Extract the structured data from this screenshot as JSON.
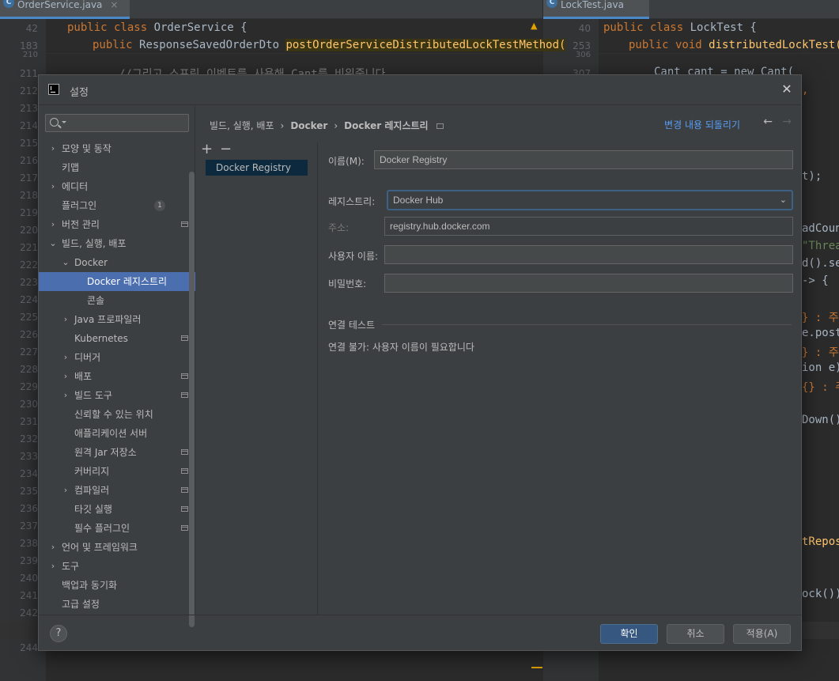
{
  "editor": {
    "left_tab": "OrderService.java",
    "right_tab": "LockTest.java",
    "left_sticky": [
      {
        "num": "42",
        "code_kw": "public class ",
        "code_rest": "OrderService {"
      },
      {
        "num": "183",
        "code_kw": "public ",
        "code_rest": "ResponseSavedOrderDto ",
        "code_fn": "postOrderServiceDistributedLockTestMethod("
      }
    ],
    "right_sticky": [
      {
        "num": "40",
        "code_kw": "public class ",
        "code_rest": "LockTest {"
      },
      {
        "num": "253",
        "code_kw": "public void ",
        "code_fn": "distributedLockTest()"
      }
    ],
    "left_comment": "//그리고 스프링 이벤트를 사용해 Cant를 비워줍니다",
    "left_line_numbers": [
      "210",
      "211",
      "212",
      "213",
      "214",
      "215",
      "216",
      "217",
      "218",
      "219",
      "220",
      "221",
      "222",
      "223",
      "224",
      "225",
      "226",
      "227",
      "228",
      "229",
      "230",
      "231",
      "232",
      "233",
      "234",
      "235",
      "236",
      "237",
      "238",
      "239",
      "240",
      "241",
      "242",
      "243",
      "244"
    ],
    "right_first_number": "306",
    "right_first_line_num": "307",
    "right_first_line": "Cant cant = new Cant(",
    "right_fragments": [
      {
        "text": ",",
        "cls": "kw"
      },
      {
        "text": "t);",
        "cls": ""
      },
      {
        "text": "adCount",
        "cls": ""
      },
      {
        "text": "\"Threa",
        "cls": "str"
      },
      {
        "text": "d().set",
        "cls": ""
      },
      {
        "text": "-> {",
        "cls": ""
      },
      {
        "text": "} : 주문",
        "cls": "kw"
      },
      {
        "text": "e.post(",
        "cls": ""
      },
      {
        "text": "} : 주문",
        "cls": "kw"
      },
      {
        "text": "ion e)",
        "cls": ""
      },
      {
        "text": "{} : 주",
        "cls": "kw"
      },
      {
        "text": "Down()",
        "cls": ""
      },
      {
        "text": "tRepos:",
        "cls": "fn"
      },
      {
        "text": "ock())",
        "cls": ""
      }
    ]
  },
  "dialog": {
    "title": "설정",
    "close_icon": "close-icon",
    "search": {
      "placeholder": ""
    },
    "tree": [
      {
        "label": "모양 및 동작",
        "level": 0,
        "chevron": "›",
        "badge": "",
        "proj": false
      },
      {
        "label": "키맵",
        "level": 0,
        "chevron": "",
        "badge": "",
        "proj": false
      },
      {
        "label": "에디터",
        "level": 0,
        "chevron": "›",
        "badge": "",
        "proj": false
      },
      {
        "label": "플러그인",
        "level": 0,
        "chevron": "",
        "badge": "1",
        "proj": false
      },
      {
        "label": "버전 관리",
        "level": 0,
        "chevron": "›",
        "badge": "",
        "proj": true
      },
      {
        "label": "빌드, 실행, 배포",
        "level": 0,
        "chevron": "⌄",
        "badge": "",
        "proj": false
      },
      {
        "label": "Docker",
        "level": 1,
        "chevron": "⌄",
        "badge": "",
        "proj": false
      },
      {
        "label": "Docker 레지스트리",
        "level": 2,
        "chevron": "",
        "badge": "",
        "proj": false,
        "selected": true
      },
      {
        "label": "콘솔",
        "level": 2,
        "chevron": "",
        "badge": "",
        "proj": false
      },
      {
        "label": "Java 프로파일러",
        "level": 1,
        "chevron": "›",
        "badge": "",
        "proj": false
      },
      {
        "label": "Kubernetes",
        "level": 1,
        "chevron": "",
        "badge": "",
        "proj": true
      },
      {
        "label": "디버거",
        "level": 1,
        "chevron": "›",
        "badge": "",
        "proj": false
      },
      {
        "label": "배포",
        "level": 1,
        "chevron": "›",
        "badge": "",
        "proj": true
      },
      {
        "label": "빌드 도구",
        "level": 1,
        "chevron": "›",
        "badge": "",
        "proj": true
      },
      {
        "label": "신뢰할 수 있는 위치",
        "level": 1,
        "chevron": "",
        "badge": "",
        "proj": false
      },
      {
        "label": "애플리케이션 서버",
        "level": 1,
        "chevron": "",
        "badge": "",
        "proj": false
      },
      {
        "label": "원격 Jar 저장소",
        "level": 1,
        "chevron": "",
        "badge": "",
        "proj": true
      },
      {
        "label": "커버리지",
        "level": 1,
        "chevron": "",
        "badge": "",
        "proj": true
      },
      {
        "label": "컴파일러",
        "level": 1,
        "chevron": "›",
        "badge": "",
        "proj": true
      },
      {
        "label": "타깃 실행",
        "level": 1,
        "chevron": "",
        "badge": "",
        "proj": true
      },
      {
        "label": "필수 플러그인",
        "level": 1,
        "chevron": "",
        "badge": "",
        "proj": true
      },
      {
        "label": "언어 및 프레임워크",
        "level": 0,
        "chevron": "›",
        "badge": "",
        "proj": false
      },
      {
        "label": "도구",
        "level": 0,
        "chevron": "›",
        "badge": "",
        "proj": false
      },
      {
        "label": "백업과 동기화",
        "level": 0,
        "chevron": "",
        "badge": "",
        "proj": false
      },
      {
        "label": "고급 설정",
        "level": 0,
        "chevron": "",
        "badge": "",
        "proj": false
      }
    ],
    "breadcrumb": {
      "part1": "빌드, 실행, 배포",
      "part2": "Docker",
      "part3": "Docker 레지스트리",
      "sep": "›"
    },
    "revert_label": "변경 내용 되돌리기",
    "nav_back": "←",
    "nav_forward": "→",
    "list": {
      "add": "+",
      "remove": "−",
      "items": [
        "Docker Registry"
      ]
    },
    "form": {
      "name_label": "이름(M):",
      "name_value": "Docker Registry",
      "registry_label": "레지스트리:",
      "registry_value": "Docker Hub",
      "address_label": "주소:",
      "address_value": "registry.hub.docker.com",
      "username_label": "사용자 이름:",
      "username_value": "",
      "password_label": "비밀번호:",
      "password_value": "",
      "section_title": "연결 테스트",
      "status": "연결 불가: 사용자 이름이 필요합니다"
    },
    "footer": {
      "help": "?",
      "ok": "확인",
      "cancel": "취소",
      "apply": "적용(A)"
    }
  }
}
